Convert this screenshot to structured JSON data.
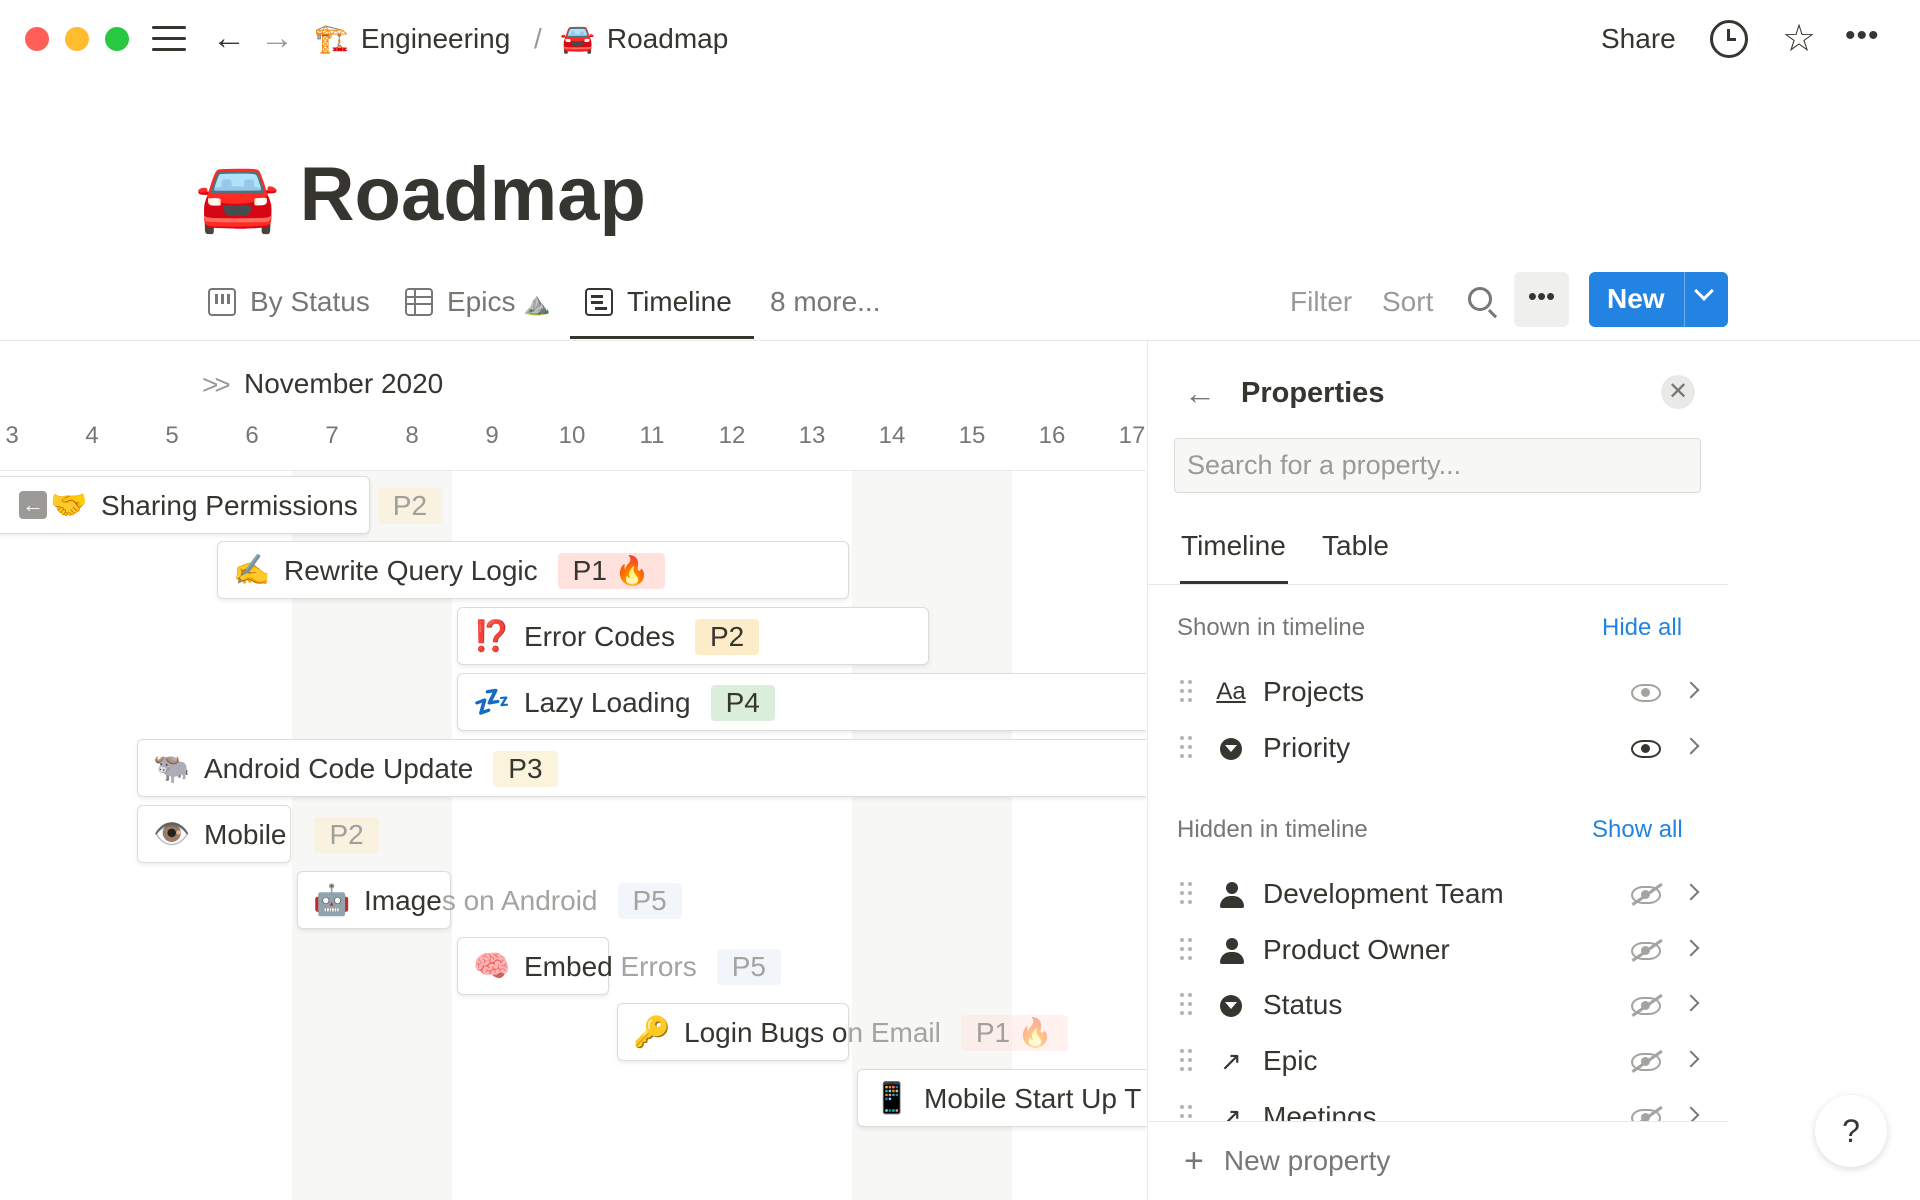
{
  "breadcrumb": {
    "workspace": {
      "emoji": "🏗️",
      "label": "Engineering"
    },
    "separator": "/",
    "page": {
      "emoji": "🚘",
      "label": "Roadmap"
    }
  },
  "header": {
    "share_label": "Share",
    "icons": [
      "clock-icon",
      "star-icon",
      "more-icon"
    ]
  },
  "page": {
    "emoji": "🚘",
    "title": "Roadmap"
  },
  "views": {
    "tabs": [
      {
        "label": "By Status",
        "icon": "board-icon"
      },
      {
        "label": "Epics",
        "suffix": "⛰️",
        "icon": "table-icon"
      },
      {
        "label": "Timeline",
        "icon": "timeline-icon",
        "active": true
      }
    ],
    "more_label": "8 more..."
  },
  "toolbar": {
    "filter_label": "Filter",
    "sort_label": "Sort",
    "more_label": "•••",
    "new_label": "New"
  },
  "timeline": {
    "month_label": "November 2020",
    "days": [
      "3",
      "4",
      "5",
      "6",
      "7",
      "8",
      "9",
      "10",
      "11",
      "12",
      "13",
      "14",
      "15",
      "16",
      "17"
    ],
    "items": [
      {
        "emoji": "🤝",
        "title": "Sharing Permissions",
        "priority": "P2"
      },
      {
        "emoji": "✍️",
        "title": "Rewrite Query Logic",
        "priority": "P1 🔥"
      },
      {
        "emoji": "⁉️",
        "title": "Error Codes",
        "priority": "P2"
      },
      {
        "emoji": "💤",
        "title": "Lazy Loading",
        "priority": "P4"
      },
      {
        "emoji": "🐃",
        "title": "Android Code Update",
        "priority": "P3"
      },
      {
        "emoji": "👁️",
        "title": "Mobile",
        "priority": "P2"
      },
      {
        "emoji": "🤖",
        "title_visible": "Image",
        "title_faded": "s on Android",
        "priority": "P5"
      },
      {
        "emoji": "🧠",
        "title_visible": "Embed",
        "title_faded": " Errors",
        "priority": "P5"
      },
      {
        "emoji": "🔑",
        "title_visible": "Login Bugs o",
        "title_faded": "n Email",
        "priority": "P1 🔥"
      },
      {
        "emoji": "📱",
        "title": "Mobile Start Up T"
      }
    ]
  },
  "properties_panel": {
    "title": "Properties",
    "search_placeholder": "Search for a property...",
    "tabs": [
      "Timeline",
      "Table"
    ],
    "shown": {
      "label": "Shown in timeline",
      "action": "Hide all",
      "items": [
        {
          "icon": "text-icon",
          "icon_glyph": "Aa",
          "name": "Projects",
          "visibility": "partial"
        },
        {
          "icon": "select-icon",
          "name": "Priority",
          "visibility": "visible"
        }
      ]
    },
    "hidden": {
      "label": "Hidden in timeline",
      "action": "Show all",
      "items": [
        {
          "icon": "person-icon",
          "name": "Development Team",
          "visibility": "hidden"
        },
        {
          "icon": "person-icon",
          "name": "Product Owner",
          "visibility": "hidden"
        },
        {
          "icon": "select-icon",
          "name": "Status",
          "visibility": "hidden"
        },
        {
          "icon": "relation-icon",
          "icon_glyph": "↗",
          "name": "Epic",
          "visibility": "hidden"
        },
        {
          "icon": "relation-icon",
          "icon_glyph": "↗",
          "name": "Meetings",
          "visibility": "hidden"
        }
      ]
    },
    "new_property_label": "New property"
  },
  "help": {
    "label": "?"
  }
}
